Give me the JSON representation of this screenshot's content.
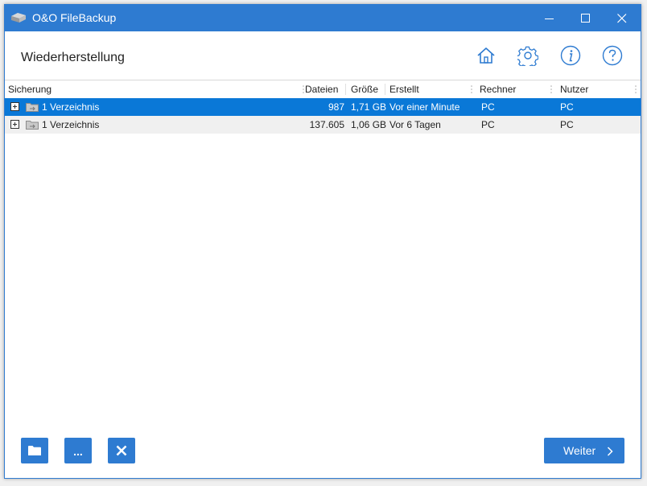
{
  "window": {
    "title": "O&O FileBackup"
  },
  "header": {
    "title": "Wiederherstellung"
  },
  "toolbar_icons": [
    "home-icon",
    "gear-icon",
    "info-icon",
    "help-icon"
  ],
  "table": {
    "columns": [
      "Sicherung",
      "Dateien",
      "Größe",
      "Erstellt",
      "Rechner",
      "Nutzer"
    ],
    "rows": [
      {
        "name": "1 Verzeichnis",
        "files": "987",
        "size": "1,71 GB",
        "created": "Vor einer Minute",
        "computer": "PC",
        "user": "PC",
        "selected": true
      },
      {
        "name": "1 Verzeichnis",
        "files": "137.605",
        "size": "1,06 GB",
        "created": "Vor 6 Tagen",
        "computer": "PC",
        "user": "PC",
        "selected": false
      }
    ]
  },
  "footer": {
    "next_label": "Weiter",
    "more_label": "..."
  },
  "colors": {
    "accent": "#2e7bd1",
    "selection": "#0a78d7"
  }
}
